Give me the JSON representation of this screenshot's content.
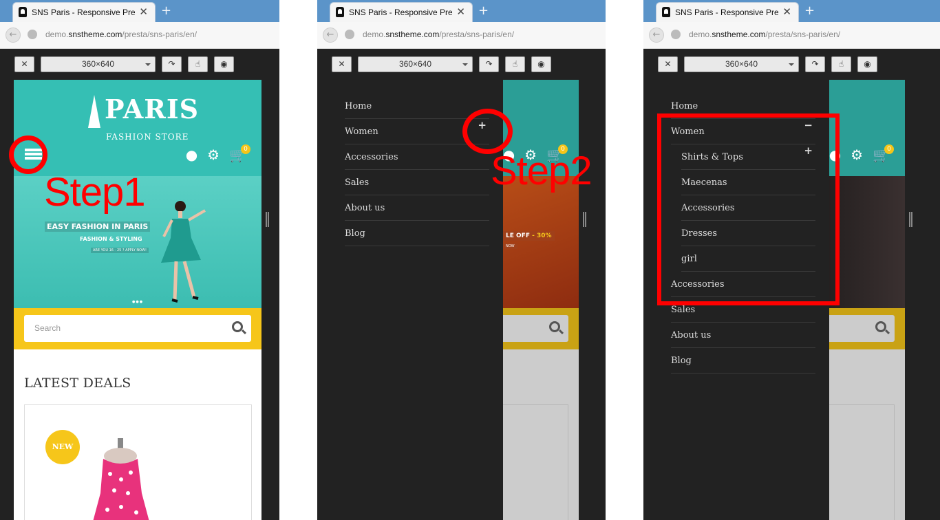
{
  "browser": {
    "tab_title": "SNS Paris - Responsive Pre...",
    "tab_close": "✕",
    "new_tab": "+",
    "url_prefix": "demo.",
    "url_domain": "snstheme.com",
    "url_path": "/presta/sns-paris/en/"
  },
  "devtools": {
    "close_icon": "✕",
    "device_size": "360×640",
    "rotate_icon": "↷",
    "touch_icon": "☝",
    "screenshot_icon": "◉"
  },
  "store": {
    "logo_big": "PARIS",
    "logo_small": "FASHION STORE",
    "cart_count": "0",
    "banner_line1": "EASY FASHION IN PARIS",
    "banner_line2": "FASHION & STYLING",
    "banner_line3": "ARE YOU 16 - 25 ? APPLY NOW!",
    "banner2_text": "LE OFF",
    "banner2_pct": "- 30%",
    "banner2_cta": "NOW",
    "search_placeholder": "Search",
    "section_title": "LATEST DEALS",
    "new_badge": "NEW"
  },
  "menu2": {
    "items": [
      "Home",
      "Women",
      "Accessories",
      "Sales",
      "About us",
      "Blog"
    ],
    "women_toggle": "+"
  },
  "menu3": {
    "home": "Home",
    "women": "Women",
    "women_toggle": "−",
    "sub_items": [
      "Shirts & Tops",
      "Maecenas",
      "Accessories",
      "Dresses",
      "girl"
    ],
    "shirts_toggle": "+",
    "rest": [
      "Accessories",
      "Sales",
      "About us",
      "Blog"
    ]
  },
  "annotations": {
    "step1": "Step1",
    "step2": "Step2"
  },
  "colors": {
    "annotation": "#ff0000",
    "header_teal": "#35bfb4",
    "search_yellow": "#f6c61a",
    "menu_bg": "#222222"
  }
}
